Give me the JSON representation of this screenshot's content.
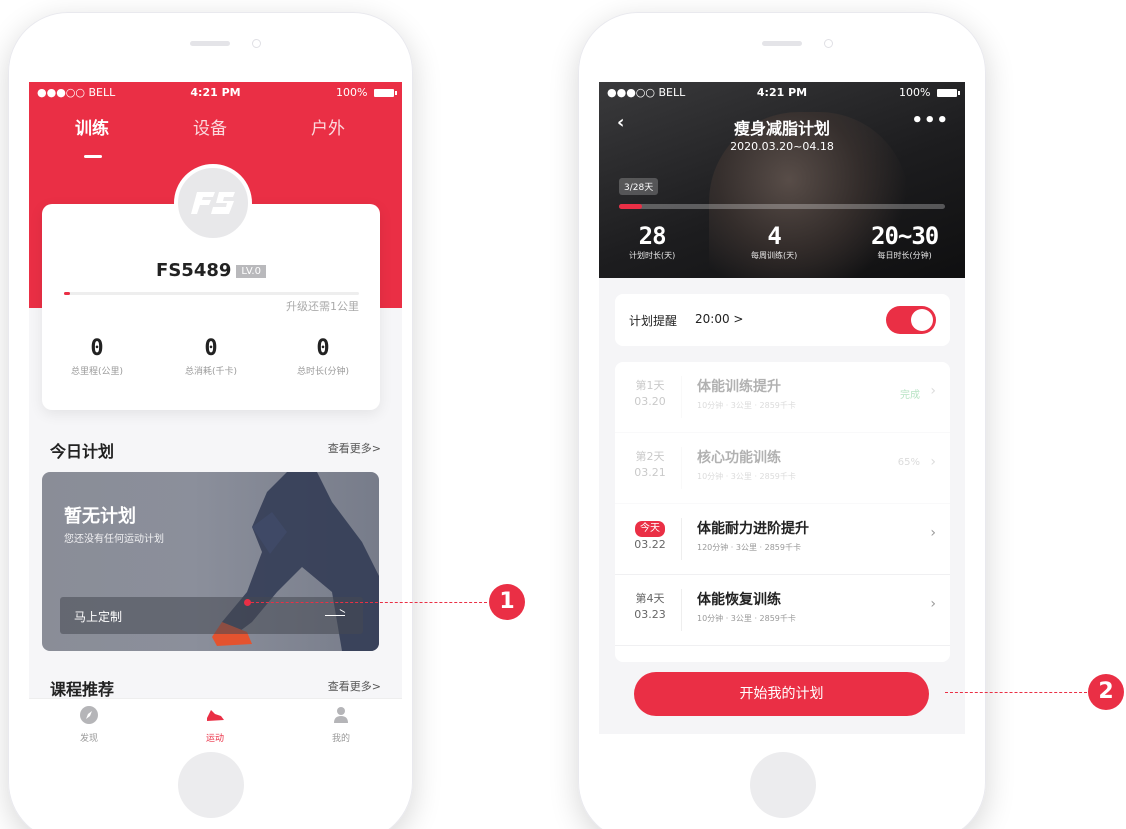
{
  "left_phone": {
    "status": {
      "carrier": "●●●○○ BELL",
      "time": "4:21 PM",
      "battery": "100%"
    },
    "tabs": [
      {
        "label": "训练"
      },
      {
        "label": "设备"
      },
      {
        "label": "户外"
      }
    ],
    "profile": {
      "username": "FS5489",
      "level": "LV.0",
      "progress_percent": 2,
      "progress_note": "升级还需1公里",
      "stats": [
        {
          "value": "0",
          "label": "总里程(公里)"
        },
        {
          "value": "0",
          "label": "总消耗(千卡)"
        },
        {
          "value": "0",
          "label": "总时长(分钟)"
        }
      ]
    },
    "today_plan": {
      "title": "今日计划",
      "more": "查看更多>",
      "card_title": "暂无计划",
      "card_subtitle": "您还没有任何运动计划",
      "custom_button": "马上定制"
    },
    "courses": {
      "title": "课程推荐",
      "more": "查看更多>"
    },
    "bottom_nav": [
      {
        "label": "发现",
        "icon": "compass-icon"
      },
      {
        "label": "运动",
        "icon": "sneaker-icon"
      },
      {
        "label": "我的",
        "icon": "person-icon"
      }
    ]
  },
  "right_phone": {
    "status": {
      "carrier": "●●●○○ BELL",
      "time": "4:21 PM",
      "battery": "100%"
    },
    "header": {
      "title": "瘦身减脂计划",
      "date_range": "2020.03.20~04.18",
      "day_pill": "3/28天",
      "progress_percent": 7
    },
    "stats": [
      {
        "value": "28",
        "label": "计划时长(天)"
      },
      {
        "value": "4",
        "label": "每周训练(天)"
      },
      {
        "value": "20~30",
        "label": "每日时长(分钟)"
      }
    ],
    "reminder": {
      "label": "计划提醒",
      "time": "20:00 >",
      "enabled": true
    },
    "days": [
      {
        "day": "第1天",
        "date": "03.20",
        "title": "体能训练提升",
        "sub": "10分钟 · 3公里 · 2859千卡",
        "status": "完成"
      },
      {
        "day": "第2天",
        "date": "03.21",
        "title": "核心功能训练",
        "sub": "10分钟 · 3公里 · 2859千卡",
        "status": "65%"
      },
      {
        "day": "今天",
        "date": "03.22",
        "title": "体能耐力进阶提升",
        "sub": "120分钟 · 3公里 · 2859千卡",
        "status": ""
      },
      {
        "day": "第4天",
        "date": "03.23",
        "title": "体能恢复训练",
        "sub": "10分钟 · 3公里 · 2859千卡",
        "status": ""
      }
    ],
    "start_button": "开始我的计划"
  },
  "annotations": [
    {
      "label": "1"
    },
    {
      "label": "2"
    }
  ],
  "colors": {
    "accent": "#ea2f45",
    "done_green": "#2eae52"
  }
}
